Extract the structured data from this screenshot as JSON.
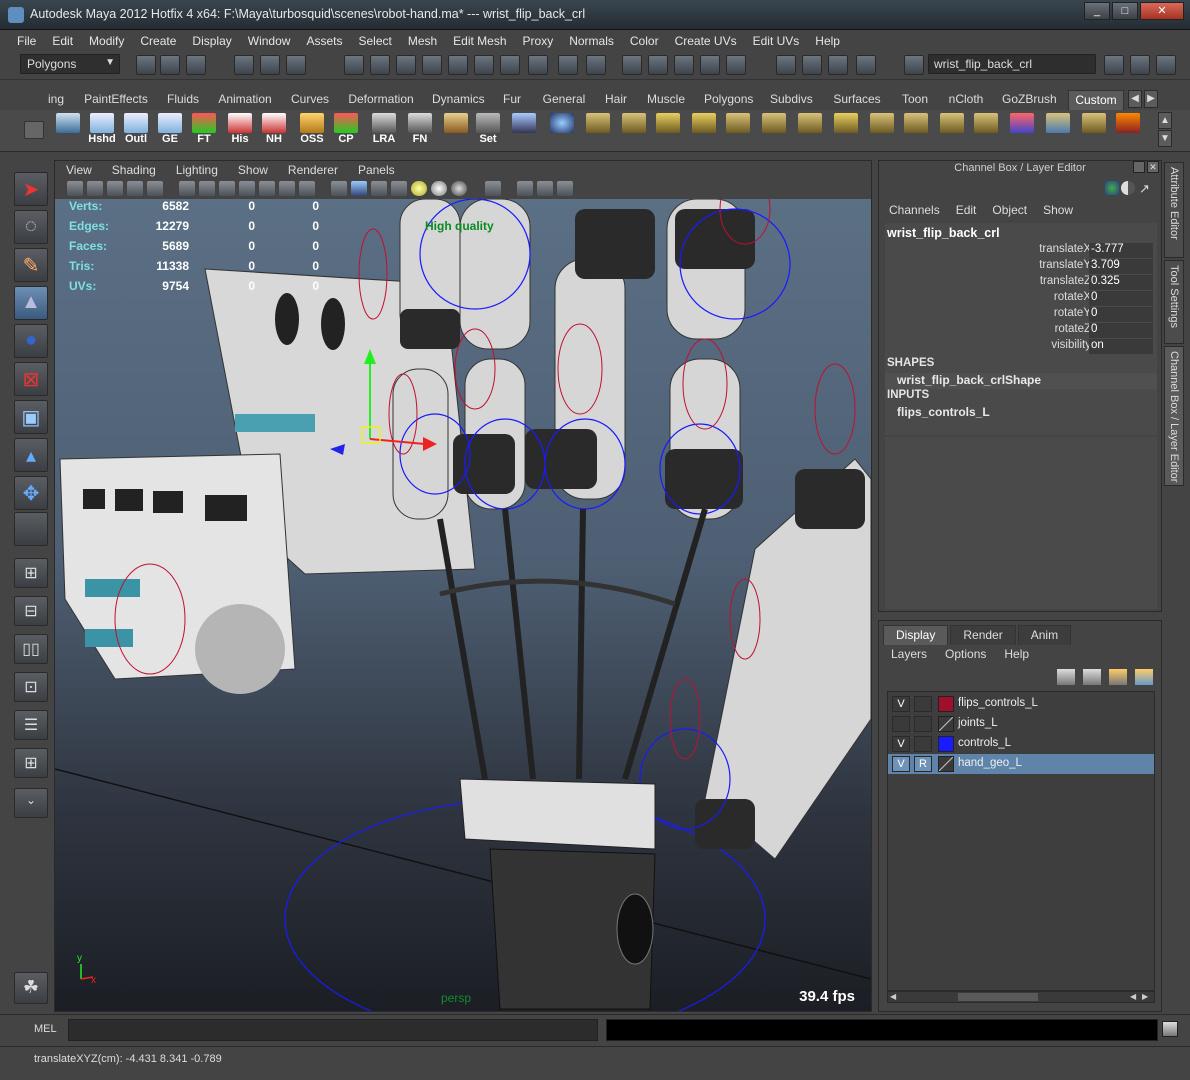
{
  "window": {
    "title": "Autodesk Maya 2012 Hotfix 4 x64: F:\\Maya\\turbosquid\\scenes\\robot-hand.ma*   ---   wrist_flip_back_crl"
  },
  "menubar": [
    "File",
    "Edit",
    "Modify",
    "Create",
    "Display",
    "Window",
    "Assets",
    "Select",
    "Mesh",
    "Edit Mesh",
    "Proxy",
    "Normals",
    "Color",
    "Create UVs",
    "Edit UVs",
    "Help"
  ],
  "statusline": {
    "mode": "Polygons",
    "name_field": "wrist_flip_back_crl"
  },
  "shelf_tabs": [
    "ing",
    "PaintEffects",
    "Fluids",
    "Animation",
    "Curves",
    "Deformation",
    "Dynamics",
    "Fur",
    "General",
    "Hair",
    "Muscle",
    "Polygons",
    "Subdivs",
    "Surfaces",
    "Toon",
    "nCloth",
    "GoZBrush",
    "Custom"
  ],
  "shelf_tab_active": "Custom",
  "shelf_buttons": [
    "Hshd",
    "Outl",
    "GE",
    "FT",
    "His",
    "NH",
    "OSS",
    "CP",
    "LRA",
    "FN",
    "Set"
  ],
  "viewport": {
    "menu": [
      "View",
      "Shading",
      "Lighting",
      "Show",
      "Renderer",
      "Panels"
    ],
    "hud": [
      {
        "label": "Verts:",
        "v1": "6582",
        "v2": "0",
        "v3": "0"
      },
      {
        "label": "Edges:",
        "v1": "12279",
        "v2": "0",
        "v3": "0"
      },
      {
        "label": "Faces:",
        "v1": "5689",
        "v2": "0",
        "v3": "0"
      },
      {
        "label": "Tris:",
        "v1": "11338",
        "v2": "0",
        "v3": "0"
      },
      {
        "label": "UVs:",
        "v1": "9754",
        "v2": "0",
        "v3": "0"
      }
    ],
    "quality_label": "High quality",
    "fps": "39.4 fps",
    "camera": "persp",
    "axis": {
      "y": "y",
      "x": "x"
    }
  },
  "channel_box": {
    "title": "Channel Box / Layer Editor",
    "menu": [
      "Channels",
      "Edit",
      "Object",
      "Show"
    ],
    "object": "wrist_flip_back_crl",
    "attributes": [
      {
        "name": "translateX",
        "value": "-3.777"
      },
      {
        "name": "translateY",
        "value": "3.709"
      },
      {
        "name": "translateZ",
        "value": "0.325"
      },
      {
        "name": "rotateX",
        "value": "0"
      },
      {
        "name": "rotateY",
        "value": "0"
      },
      {
        "name": "rotateZ",
        "value": "0"
      },
      {
        "name": "visibility",
        "value": "on"
      }
    ],
    "shapes_label": "SHAPES",
    "shape": "wrist_flip_back_crlShape",
    "inputs_label": "INPUTS",
    "input": "flips_controls_L"
  },
  "side_tabs": [
    "Attribute Editor",
    "Tool Settings",
    "Channel Box / Layer Editor"
  ],
  "layer_editor": {
    "tabs": [
      "Display",
      "Render",
      "Anim"
    ],
    "active_tab": "Display",
    "menu": [
      "Layers",
      "Options",
      "Help"
    ],
    "layers": [
      {
        "v": "V",
        "r": "",
        "name": "flips_controls_L",
        "color": "#a0102a"
      },
      {
        "v": "",
        "r": "",
        "name": "joints_L",
        "color": ""
      },
      {
        "v": "V",
        "r": "",
        "name": "controls_L",
        "color": "#1a1aff"
      },
      {
        "v": "V",
        "r": "R",
        "name": "hand_geo_L",
        "color": ""
      }
    ]
  },
  "command_line": {
    "label": "MEL"
  },
  "help_line": "translateXYZ(cm):   -4.431        8.341     -0.789"
}
